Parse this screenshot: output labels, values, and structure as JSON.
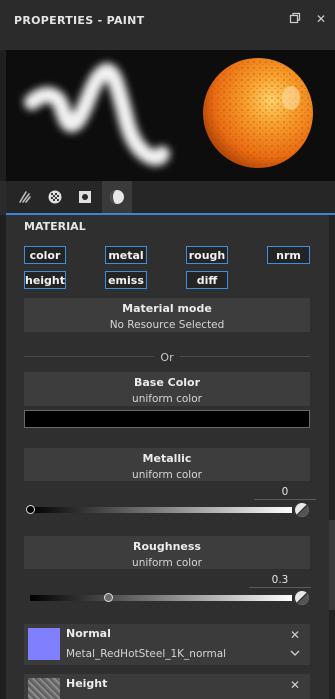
{
  "panel": {
    "title": "PROPERTIES - PAINT",
    "restore_icon": "restore-icon",
    "close_symbol": "✕"
  },
  "preview": {
    "stroke_icon": "brush-stroke-preview",
    "sphere_icon": "material-sphere-preview",
    "sphere_color": "#f08a1e"
  },
  "tabs": [
    {
      "name": "tab-brush",
      "icon": "brush-icon",
      "active": false
    },
    {
      "name": "tab-alpha",
      "icon": "checker-sphere-icon",
      "active": false
    },
    {
      "name": "tab-stencil",
      "icon": "square-dot-icon",
      "active": false
    },
    {
      "name": "tab-material",
      "icon": "material-icon",
      "active": true
    }
  ],
  "material": {
    "title": "MATERIAL",
    "channels": [
      "color",
      "metal",
      "rough",
      "nrm",
      "height",
      "emiss",
      "diff"
    ],
    "mode": {
      "title": "Material mode",
      "value": "No Resource Selected"
    },
    "or_label": "Or",
    "base_color": {
      "title": "Base Color",
      "subtitle": "uniform color",
      "swatch_color": "#000000"
    },
    "metallic": {
      "title": "Metallic",
      "subtitle": "uniform color",
      "value": "0",
      "level": 0
    },
    "roughness": {
      "title": "Roughness",
      "subtitle": "uniform color",
      "value": "0.3",
      "level": 0.3
    },
    "normal": {
      "title": "Normal",
      "file": "Metal_RedHotSteel_1K_normal",
      "thumb_color": "#8080ff"
    },
    "height": {
      "title": "Height"
    }
  },
  "accent_color": "#3f8fe0"
}
